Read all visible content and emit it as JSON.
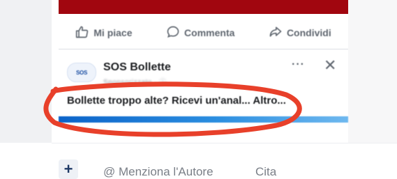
{
  "post": {
    "actions": {
      "like_label": "Mi piace",
      "comment_label": "Commenta",
      "share_label": "Condividi"
    }
  },
  "ad": {
    "logo_text": "SOS",
    "sponsor_name": "SOS Bollette",
    "sub_label": "Sponsorizzato · ⓘ",
    "more_icon": "···",
    "close_icon": "✕",
    "headline": "Bollette troppo alte? Ricevi un'anal... Altro..."
  },
  "composer": {
    "plus_label": "+",
    "mention_label": "@ Menziona l'Autore",
    "cite_label": "Cita"
  },
  "colors": {
    "hero": "#a1060f",
    "accent_bar": "#0b63c9",
    "annotation": "#e8402a"
  },
  "annotation": {
    "shape": "red hand-drawn ellipse around the ad headline"
  }
}
